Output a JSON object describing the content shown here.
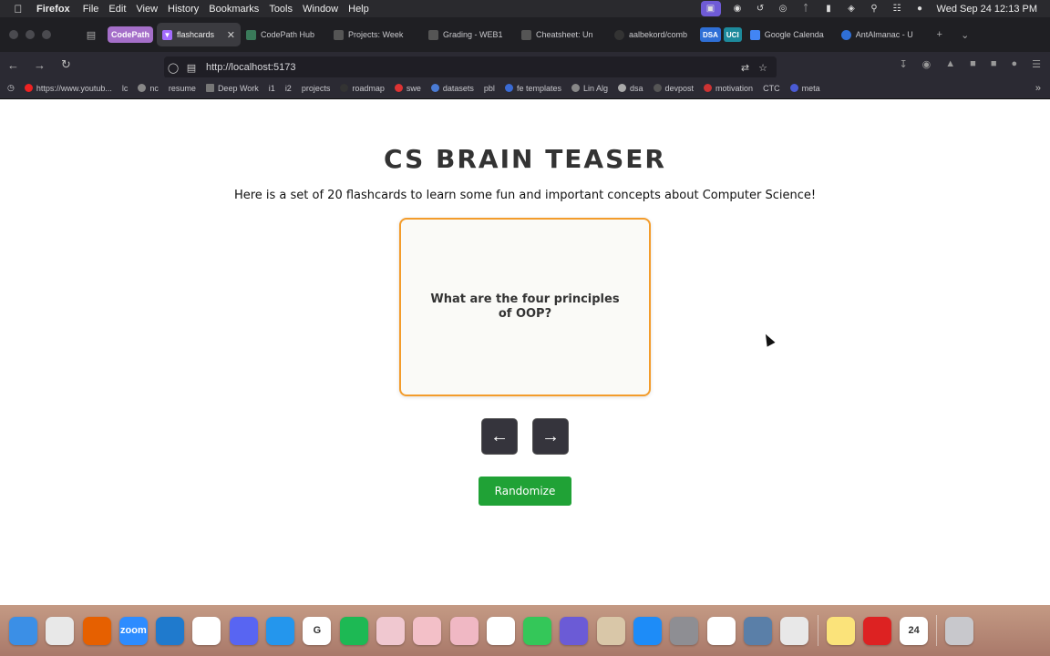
{
  "menubar": {
    "app": "Firefox",
    "menus": [
      "File",
      "Edit",
      "View",
      "History",
      "Bookmarks",
      "Tools",
      "Window",
      "Help"
    ],
    "clock": "Wed Sep 24  12:13 PM",
    "status_icons": [
      "screen-share-icon",
      "record-icon",
      "time-machine-icon",
      "airdrop-icon",
      "bluetooth-icon",
      "battery-icon",
      "wifi-icon",
      "spotlight-icon",
      "control-center-icon",
      "siri-icon"
    ]
  },
  "browser": {
    "tabs": [
      {
        "label": "CodePath",
        "type": "group",
        "color": "#a56fc9"
      },
      {
        "label": "flashcards",
        "type": "active",
        "icon": "vite-icon"
      },
      {
        "label": "CodePath Hub",
        "icon": "page-icon"
      },
      {
        "label": "Projects: Week",
        "icon": "canvas-icon"
      },
      {
        "label": "Grading - WEB1",
        "icon": "canvas-icon"
      },
      {
        "label": "Cheatsheet: Un",
        "icon": "canvas-icon"
      },
      {
        "label": "aalbekord/comb",
        "icon": "github-icon"
      },
      {
        "label": "DSA",
        "type": "tag",
        "color": "#2f6fd6"
      },
      {
        "label": "UCI",
        "type": "tag",
        "color": "#1d8a9c"
      },
      {
        "label": "Google Calenda",
        "icon": "calendar-icon"
      },
      {
        "label": "AntAlmanac - U",
        "icon": "antalmanac-icon"
      }
    ],
    "url": "http://localhost:5173",
    "bookmarks": [
      {
        "label": "https://www.youtub...",
        "color": "#e22"
      },
      {
        "label": "lc",
        "color": "#f5a623"
      },
      {
        "label": "nc",
        "color": "#888"
      },
      {
        "label": "resume",
        "color": "#555"
      },
      {
        "label": "Deep Work",
        "color": "#777"
      },
      {
        "label": "i1",
        "color": "#555"
      },
      {
        "label": "i2",
        "color": "#555"
      },
      {
        "label": "projects",
        "color": "#555"
      },
      {
        "label": "roadmap",
        "color": "#333"
      },
      {
        "label": "swe",
        "color": "#d33"
      },
      {
        "label": "datasets",
        "color": "#4a7bd4"
      },
      {
        "label": "pbl",
        "color": "#555"
      },
      {
        "label": "fe templates",
        "color": "#3a6bd4"
      },
      {
        "label": "Lin Alg",
        "color": "#888"
      },
      {
        "label": "dsa",
        "color": "#aaa"
      },
      {
        "label": "devpost",
        "color": "#555"
      },
      {
        "label": "motivation",
        "color": "#c33"
      },
      {
        "label": "CTC",
        "color": "#444"
      },
      {
        "label": "meta",
        "color": "#4a5bd4"
      }
    ]
  },
  "page": {
    "title": "CS BRAIN TEASER",
    "subtitle": "Here is a set of 20 flashcards to learn some fun and important concepts about Computer Science!",
    "card_text": "What are the four principles of OOP?",
    "prev_label": "←",
    "next_label": "→",
    "randomize_label": "Randomize"
  },
  "colors": {
    "card_border": "#f39c2b",
    "randomize_bg": "#20a236",
    "arrow_bg": "#35343c"
  },
  "dock": [
    {
      "name": "finder-icon",
      "color": "#3b8fe6",
      "glyph": ""
    },
    {
      "name": "launchpad-icon",
      "color": "#e8e8e8",
      "glyph": ""
    },
    {
      "name": "firefox-icon",
      "color": "#e66000",
      "glyph": ""
    },
    {
      "name": "zoom-icon",
      "color": "#2d8cff",
      "glyph": "zoom"
    },
    {
      "name": "vscode-icon",
      "color": "#1f7acd",
      "glyph": ""
    },
    {
      "name": "slack-icon",
      "color": "#ffffff",
      "glyph": ""
    },
    {
      "name": "discord-icon",
      "color": "#5865f2",
      "glyph": ""
    },
    {
      "name": "docker-icon",
      "color": "#2496ed",
      "glyph": ""
    },
    {
      "name": "goodnotes-icon",
      "color": "#ffffff",
      "glyph": "G"
    },
    {
      "name": "spotify-icon",
      "color": "#1db954",
      "glyph": ""
    },
    {
      "name": "app-icon-1",
      "color": "#f0c8d0",
      "glyph": ""
    },
    {
      "name": "app-icon-2",
      "color": "#f3c0c8",
      "glyph": ""
    },
    {
      "name": "app-icon-3",
      "color": "#f0b8c4",
      "glyph": ""
    },
    {
      "name": "shield-app-icon",
      "color": "#ffffff",
      "glyph": ""
    },
    {
      "name": "messages-icon",
      "color": "#34c759",
      "glyph": ""
    },
    {
      "name": "perplexity-icon",
      "color": "#6b5bd6",
      "glyph": ""
    },
    {
      "name": "preview-icon",
      "color": "#d9c7a8",
      "glyph": ""
    },
    {
      "name": "app-store-icon",
      "color": "#1d8cf8",
      "glyph": ""
    },
    {
      "name": "system-settings-icon",
      "color": "#8e8e93",
      "glyph": ""
    },
    {
      "name": "chrome-icon",
      "color": "#ffffff",
      "glyph": ""
    },
    {
      "name": "screenshot-icon",
      "color": "#5a7fa8",
      "glyph": ""
    },
    {
      "name": "phone-mirroring-icon",
      "color": "#e8e8e8",
      "glyph": ""
    },
    {
      "name": "notes-icon",
      "color": "#fbe37a",
      "glyph": ""
    },
    {
      "name": "terminal-icon",
      "color": "#d22",
      "glyph": ""
    },
    {
      "name": "calendar-icon",
      "color": "#ffffff",
      "glyph": "24"
    },
    {
      "name": "trash-icon",
      "color": "#c8c8cc",
      "glyph": ""
    }
  ]
}
